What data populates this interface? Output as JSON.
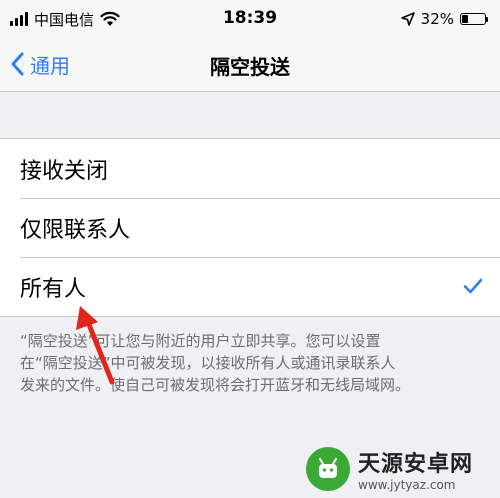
{
  "status_bar": {
    "carrier": "中国电信",
    "time": "18:39",
    "battery_percent": "32%",
    "battery_level": 0.32,
    "icons": [
      "signal-icon",
      "wifi-icon",
      "location-icon",
      "battery-icon"
    ]
  },
  "nav": {
    "back_label": "通用",
    "title": "隔空投送"
  },
  "options": [
    {
      "label": "接收关闭",
      "selected": false
    },
    {
      "label": "仅限联系人",
      "selected": false
    },
    {
      "label": "所有人",
      "selected": true
    }
  ],
  "footer": {
    "lines": [
      "“隔空投送”可让您与附近的用户立即共享。您可以设置",
      "在“隔空投送”中可被发现，以接收所有人或通讯录联系人",
      "发来的文件。使自己可被发现将会打开蓝牙和无线局域网。"
    ]
  },
  "watermark": {
    "title": "天源安卓网",
    "url": "www.jytyaz.com"
  },
  "colors": {
    "accent": "#2f7cf6",
    "annotation_arrow": "#e0261b",
    "watermark_green": "#3aa935"
  }
}
